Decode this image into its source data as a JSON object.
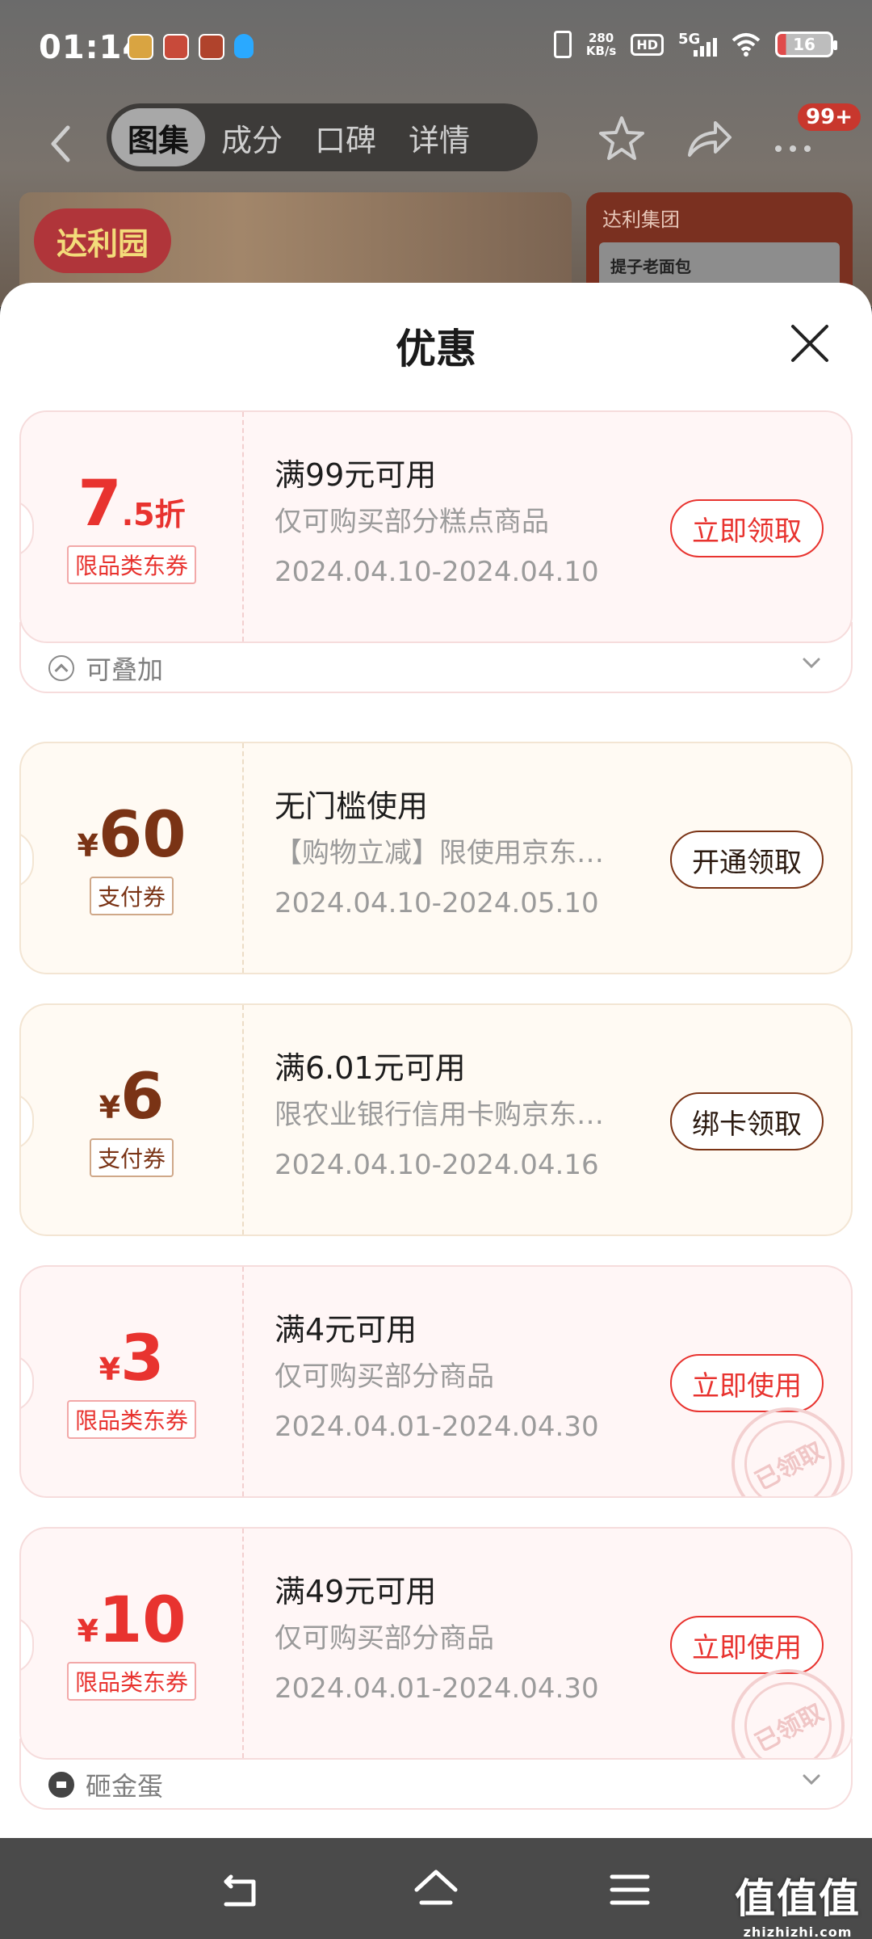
{
  "status_bar": {
    "time": "01:14",
    "net_speed_value": "280",
    "net_speed_unit": "KB/s",
    "hd": "HD",
    "network": "5G",
    "battery": "16"
  },
  "nav": {
    "tabs": [
      {
        "label": "图集",
        "active": true
      },
      {
        "label": "成分",
        "active": false
      },
      {
        "label": "口碑",
        "active": false
      },
      {
        "label": "详情",
        "active": false
      }
    ],
    "badge": "99+"
  },
  "background": {
    "logo_text": "达利园",
    "card_title": "达利集团",
    "card_item": "提子老面包"
  },
  "sheet": {
    "title": "优惠",
    "coupons": [
      {
        "theme": "red",
        "currency": "",
        "value": "7",
        "value_suffix": ".5折",
        "tag": "限品类东券",
        "title": "满99元可用",
        "desc": "仅可购买部分糕点商品",
        "date": "2024.04.10-2024.04.10",
        "button": "立即领取",
        "claimed": false,
        "footer": {
          "label": "可叠加",
          "icon": "stack-icon"
        }
      },
      {
        "theme": "gold",
        "currency": "¥",
        "value": "60",
        "value_suffix": "",
        "tag": "支付券",
        "title": "无门槛使用",
        "desc": "【购物立减】限使用京东…",
        "date": "2024.04.10-2024.05.10",
        "button": "开通领取",
        "claimed": false
      },
      {
        "theme": "gold",
        "currency": "¥",
        "value": "6",
        "value_suffix": "",
        "tag": "支付券",
        "title": "满6.01元可用",
        "desc": "限农业银行信用卡购京东…",
        "date": "2024.04.10-2024.04.16",
        "button": "绑卡领取",
        "claimed": false
      },
      {
        "theme": "red",
        "currency": "¥",
        "value": "3",
        "value_suffix": "",
        "tag": "限品类东券",
        "title": "满4元可用",
        "desc": "仅可购买部分商品",
        "date": "2024.04.01-2024.04.30",
        "button": "立即使用",
        "claimed": true,
        "stamp": "已领取"
      },
      {
        "theme": "red",
        "currency": "¥",
        "value": "10",
        "value_suffix": "",
        "tag": "限品类东券",
        "title": "满49元可用",
        "desc": "仅可购买部分商品",
        "date": "2024.04.01-2024.04.30",
        "button": "立即使用",
        "claimed": true,
        "stamp": "已领取",
        "footer": {
          "label": "砸金蛋",
          "icon": "egg-icon"
        }
      }
    ]
  },
  "watermark": {
    "main": "值值值",
    "sub": "zhizhizhi.com"
  },
  "colors": {
    "accent_red": "#e8332f",
    "accent_brown": "#7a3315",
    "coupon_red_bg": "#fff6f6",
    "coupon_gold_bg": "#fffaf3"
  }
}
